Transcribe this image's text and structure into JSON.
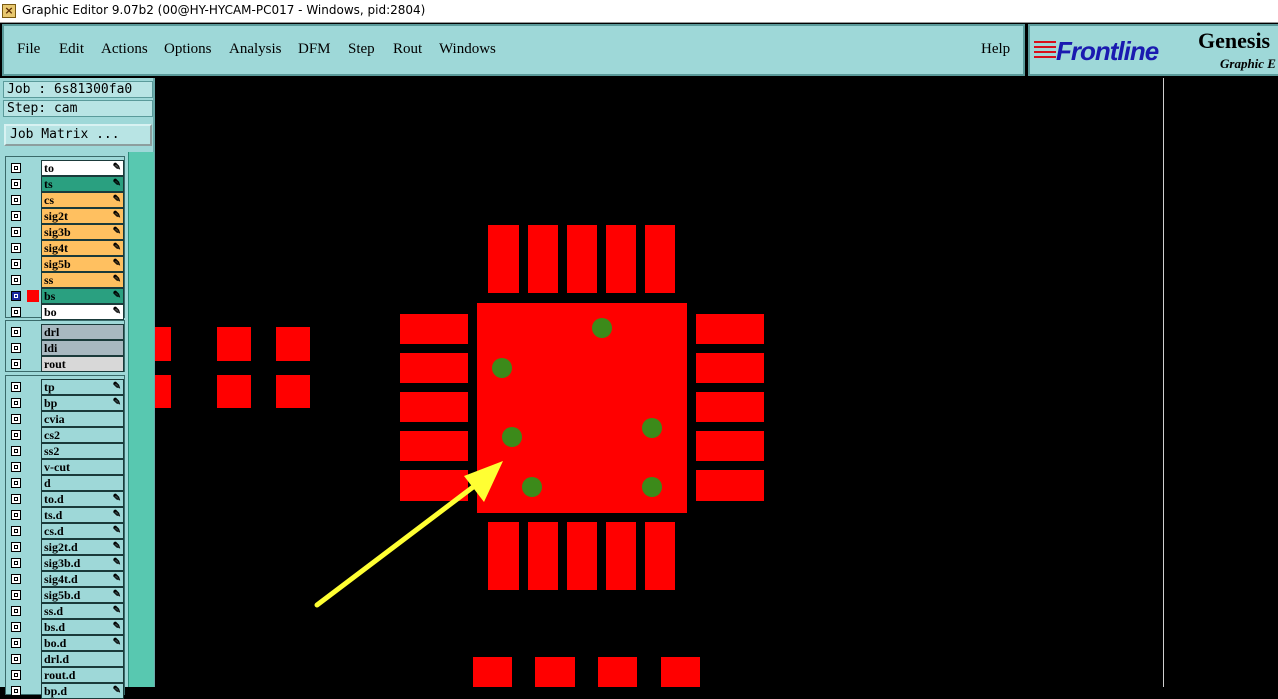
{
  "window": {
    "title": "Graphic Editor 9.07b2 (00@HY-HYCAM-PC017 - Windows, pid:2804)",
    "app_icon": "x-icon"
  },
  "menu": {
    "items": [
      "File",
      "Edit",
      "Actions",
      "Options",
      "Analysis",
      "DFM",
      "Step",
      "Rout",
      "Windows"
    ],
    "help": "Help"
  },
  "brand": {
    "logo": "Frontline",
    "product": "Genesis",
    "subtitle": "Graphic E"
  },
  "job": {
    "job_label": "Job : 6s81300fa0",
    "step_label": "Step: cam",
    "matrix_button": "Job Matrix ..."
  },
  "layers": {
    "board": [
      {
        "name": "to",
        "color": "#ffffff",
        "editable": true
      },
      {
        "name": "ts",
        "color": "#2aa080",
        "editable": true
      },
      {
        "name": "cs",
        "color": "#ffc060",
        "editable": true
      },
      {
        "name": "sig2t",
        "color": "#ffc060",
        "editable": true
      },
      {
        "name": "sig3b",
        "color": "#ffc060",
        "editable": true
      },
      {
        "name": "sig4t",
        "color": "#ffc060",
        "editable": true
      },
      {
        "name": "sig5b",
        "color": "#ffc060",
        "editable": true
      },
      {
        "name": "ss",
        "color": "#ffc060",
        "editable": true
      },
      {
        "name": "bs",
        "color": "#2aa080",
        "editable": true,
        "active": true,
        "swatch": "#ff0000"
      },
      {
        "name": "bo",
        "color": "#ffffff",
        "editable": true
      }
    ],
    "drill": [
      {
        "name": "drl",
        "color": "#a8b8c0",
        "editable": false
      },
      {
        "name": "ldi",
        "color": "#a8b8c0",
        "editable": false
      },
      {
        "name": "rout",
        "color": "#d8d8d8",
        "editable": false
      }
    ],
    "misc": [
      {
        "name": "tp",
        "color": "#9ed8d8",
        "editable": true
      },
      {
        "name": "bp",
        "color": "#9ed8d8",
        "editable": true
      },
      {
        "name": "cvia",
        "color": "#9ed8d8",
        "editable": false
      },
      {
        "name": "cs2",
        "color": "#9ed8d8",
        "editable": false
      },
      {
        "name": "ss2",
        "color": "#9ed8d8",
        "editable": false
      },
      {
        "name": "v-cut",
        "color": "#9ed8d8",
        "editable": false
      },
      {
        "name": "d",
        "color": "#9ed8d8",
        "editable": false
      },
      {
        "name": "to.d",
        "color": "#9ed8d8",
        "editable": true
      },
      {
        "name": "ts.d",
        "color": "#9ed8d8",
        "editable": true
      },
      {
        "name": "cs.d",
        "color": "#9ed8d8",
        "editable": true
      },
      {
        "name": "sig2t.d",
        "color": "#9ed8d8",
        "editable": true
      },
      {
        "name": "sig3b.d",
        "color": "#9ed8d8",
        "editable": true
      },
      {
        "name": "sig4t.d",
        "color": "#9ed8d8",
        "editable": true
      },
      {
        "name": "sig5b.d",
        "color": "#9ed8d8",
        "editable": true
      },
      {
        "name": "ss.d",
        "color": "#9ed8d8",
        "editable": true
      },
      {
        "name": "bs.d",
        "color": "#9ed8d8",
        "editable": true
      },
      {
        "name": "bo.d",
        "color": "#9ed8d8",
        "editable": true
      },
      {
        "name": "drl.d",
        "color": "#9ed8d8",
        "editable": false
      },
      {
        "name": "rout.d",
        "color": "#9ed8d8",
        "editable": false
      },
      {
        "name": "bp.d",
        "color": "#9ed8d8",
        "editable": true
      }
    ]
  },
  "colors": {
    "pad": "#ff0000",
    "via": "#3c8a1a",
    "annotation_arrow": "#ffff33",
    "canvas_background": "#000000",
    "panel": "#9ed8d8"
  }
}
